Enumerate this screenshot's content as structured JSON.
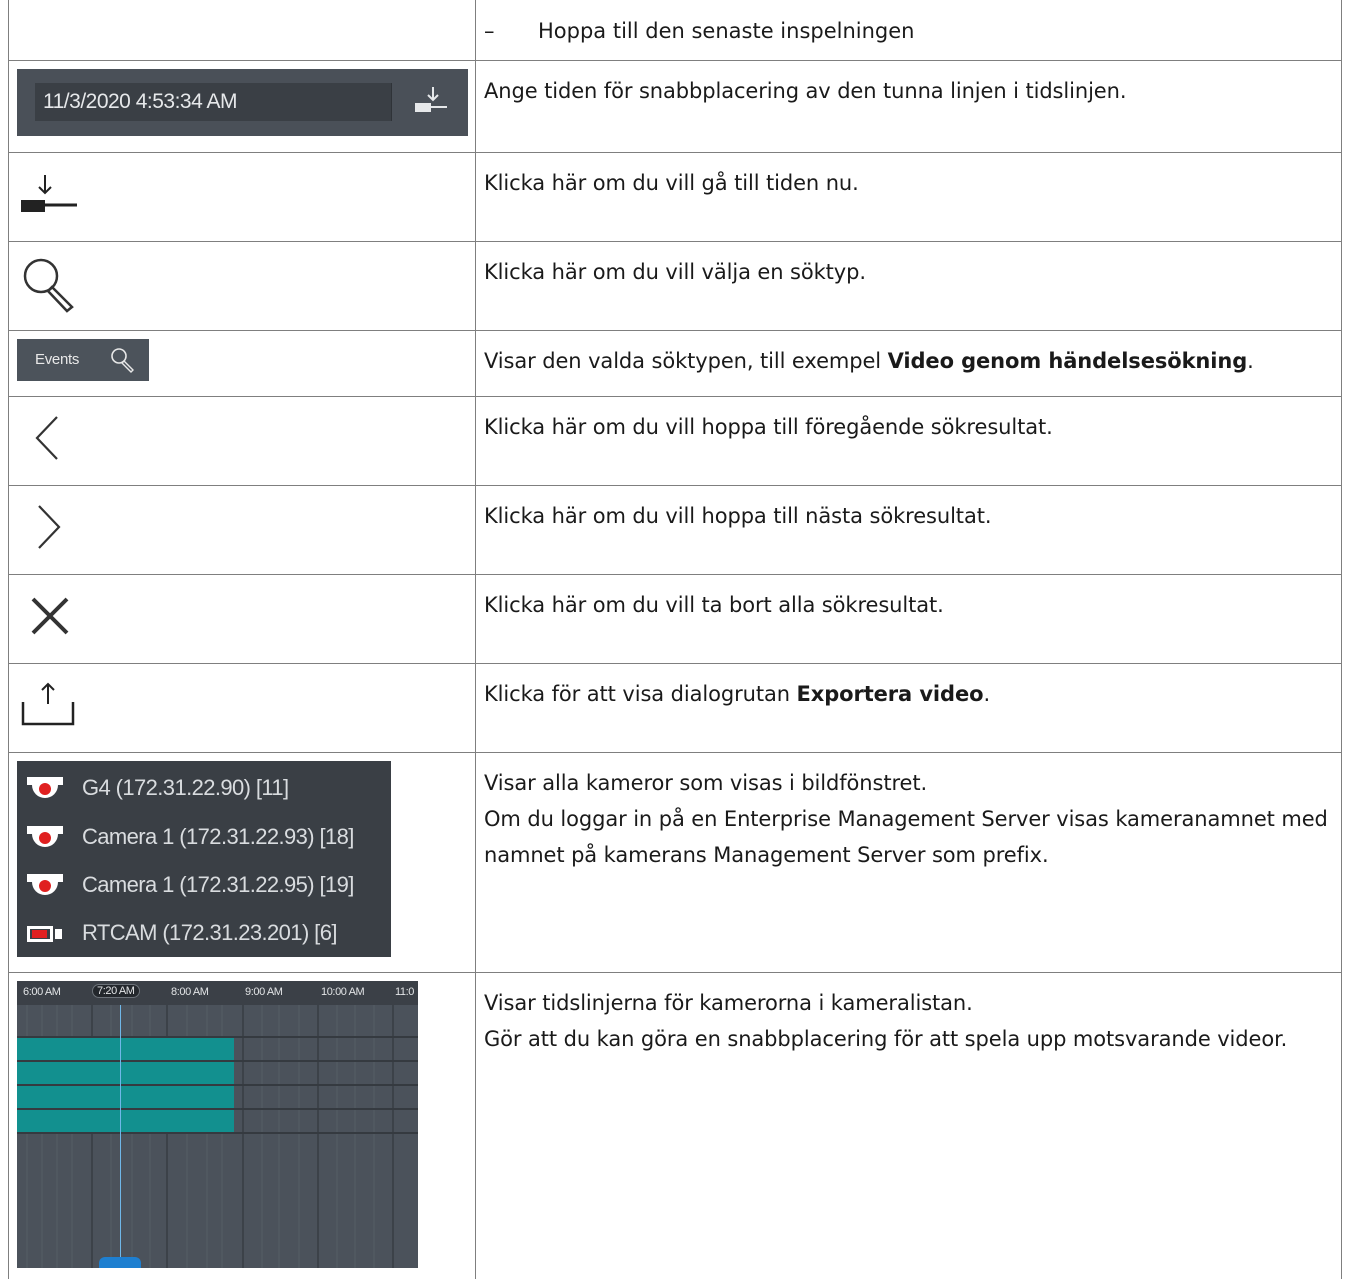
{
  "rows": [
    {
      "id": "r0",
      "description": "Hoppa till den senaste inspelningen",
      "dash": "–"
    },
    {
      "id": "r1",
      "description": "Ange tiden för snabbplacering av den tunna linjen i tidslinjen."
    },
    {
      "id": "r2",
      "description": "Klicka här om du vill gå till tiden nu."
    },
    {
      "id": "r3",
      "description": "Klicka här om du vill välja en söktyp."
    },
    {
      "id": "r4",
      "description_pre": "Visar den valda söktypen, till exempel ",
      "description_bold": "Video genom händelsesökning",
      "description_post": "."
    },
    {
      "id": "r5",
      "description": "Klicka här om du vill hoppa till föregående sökresultat."
    },
    {
      "id": "r6",
      "description": "Klicka här om du vill hoppa till nästa sökresultat."
    },
    {
      "id": "r7",
      "description": "Klicka här om du vill ta bort alla sökresultat."
    },
    {
      "id": "r8",
      "description_pre": "Klicka för att visa dialogrutan ",
      "description_bold": "Exportera video",
      "description_post": "."
    },
    {
      "id": "r9",
      "line1": "Visar alla kameror som visas i bildfönstret.",
      "line2": "Om du loggar in på en Enterprise Management Server visas kameranamnet med namnet på kamerans Management Server som prefix."
    },
    {
      "id": "r10",
      "line1": "Visar tidslinjerna för kamerorna i kameralistan.",
      "line2": "Gör att du kan göra en snabbplacering för att spela upp motsvarande videor."
    }
  ],
  "timestamp_widget": {
    "value": "11/3/2020 4:53:34 AM",
    "icon": "jump-to-now-icon"
  },
  "icons": {
    "now": "jump-to-now-icon",
    "search": "search-icon",
    "prev": "chevron-left-icon",
    "next": "chevron-right-icon",
    "clear": "close-icon",
    "export": "export-icon"
  },
  "search_type_button": {
    "label": "Events",
    "icon": "search-icon"
  },
  "camera_list": [
    {
      "name": "G4 (172.31.22.90) [11]",
      "icon": "dome-camera-icon"
    },
    {
      "name": "Camera 1 (172.31.22.93) [18]",
      "icon": "dome-camera-icon"
    },
    {
      "name": "Camera 1 (172.31.22.95) [19]",
      "icon": "dome-camera-icon"
    },
    {
      "name": "RTCAM (172.31.23.201) [6]",
      "icon": "box-camera-icon"
    }
  ],
  "timeline": {
    "ticks": [
      "6:00 AM",
      "7:20 AM",
      "8:00 AM",
      "9:00 AM",
      "10:00 AM",
      "11:0"
    ],
    "current": "7:20 AM",
    "track_color": "#12908f",
    "background": "#49505a"
  }
}
